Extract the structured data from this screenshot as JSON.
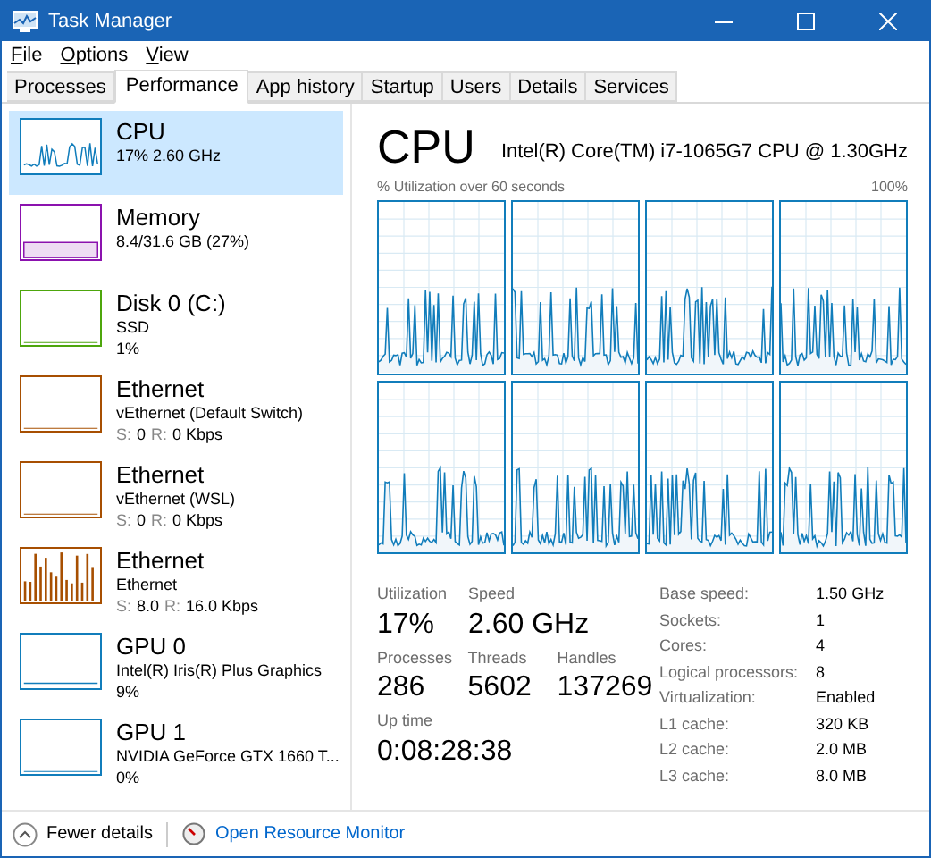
{
  "window": {
    "title": "Task Manager"
  },
  "menu": [
    "File",
    "Options",
    "View"
  ],
  "tabs": [
    {
      "label": "Processes",
      "selected": false
    },
    {
      "label": "Performance",
      "selected": true
    },
    {
      "label": "App history",
      "selected": false
    },
    {
      "label": "Startup",
      "selected": false
    },
    {
      "label": "Users",
      "selected": false
    },
    {
      "label": "Details",
      "selected": false
    },
    {
      "label": "Services",
      "selected": false
    }
  ],
  "sidebar": {
    "items": [
      {
        "kind": "spiky",
        "name": "CPU",
        "lines": [
          "17% 2.60 GHz"
        ],
        "color": "#117dbb",
        "selected": true
      },
      {
        "kind": "filled",
        "name": "Memory",
        "lines": [
          "8.4/31.6 GB (27%)"
        ],
        "color": "#8b12ae",
        "selected": false
      },
      {
        "kind": "flat",
        "name": "Disk 0 (C:)",
        "lines": [
          "SSD",
          "1%"
        ],
        "color": "#4da60c",
        "selected": false
      },
      {
        "kind": "flat",
        "name": "Ethernet",
        "lines": [
          "vEthernet (Default Switch)"
        ],
        "rate": {
          "send_label": "S:",
          "send": "0",
          "recv_label": "R:",
          "recv": "0 Kbps"
        },
        "color": "#a74f01",
        "selected": false
      },
      {
        "kind": "flat",
        "name": "Ethernet",
        "lines": [
          "vEthernet (WSL)"
        ],
        "rate": {
          "send_label": "S:",
          "send": "0",
          "recv_label": "R:",
          "recv": "0 Kbps"
        },
        "color": "#a74f01",
        "selected": false
      },
      {
        "kind": "bars",
        "name": "Ethernet",
        "lines": [
          "Ethernet"
        ],
        "rate": {
          "send_label": "S:",
          "send": "8.0",
          "recv_label": "R:",
          "recv": "16.0 Kbps"
        },
        "color": "#a74f01",
        "selected": false
      },
      {
        "kind": "low",
        "name": "GPU 0",
        "lines": [
          "Intel(R) Iris(R) Plus Graphics",
          "9%"
        ],
        "color": "#117dbb",
        "selected": false
      },
      {
        "kind": "flat",
        "name": "GPU 1",
        "lines": [
          "NVIDIA GeForce GTX 1660 T...",
          "0%"
        ],
        "color": "#117dbb",
        "selected": false
      }
    ]
  },
  "panel": {
    "title": "CPU",
    "model": "Intel(R) Core(TM) i7-1065G7 CPU @ 1.30GHz",
    "graph_label": "% Utilization over 60 seconds",
    "graph_max": "100%",
    "stats": [
      [
        {
          "label": "Utilization",
          "value": "17%"
        },
        {
          "label": "Speed",
          "value": "2.60 GHz"
        }
      ],
      [
        {
          "label": "Processes",
          "value": "286"
        },
        {
          "label": "Threads",
          "value": "5602"
        },
        {
          "label": "Handles",
          "value": "137269"
        }
      ],
      [
        {
          "label": "Up time",
          "value": "0:08:28:38"
        }
      ]
    ],
    "details": [
      {
        "label": "Base speed:",
        "value": "1.50 GHz"
      },
      {
        "label": "Sockets:",
        "value": "1"
      },
      {
        "label": "Cores:",
        "value": "4"
      },
      {
        "label": "Logical processors:",
        "value": "8"
      },
      {
        "label": "Virtualization:",
        "value": "Enabled"
      },
      {
        "label": "L1 cache:",
        "value": "320 KB"
      },
      {
        "label": "L2 cache:",
        "value": "2.0 MB"
      },
      {
        "label": "L3 cache:",
        "value": "8.0 MB"
      }
    ]
  },
  "footer": {
    "fewer": "Fewer details",
    "monitor": "Open Resource Monitor"
  }
}
